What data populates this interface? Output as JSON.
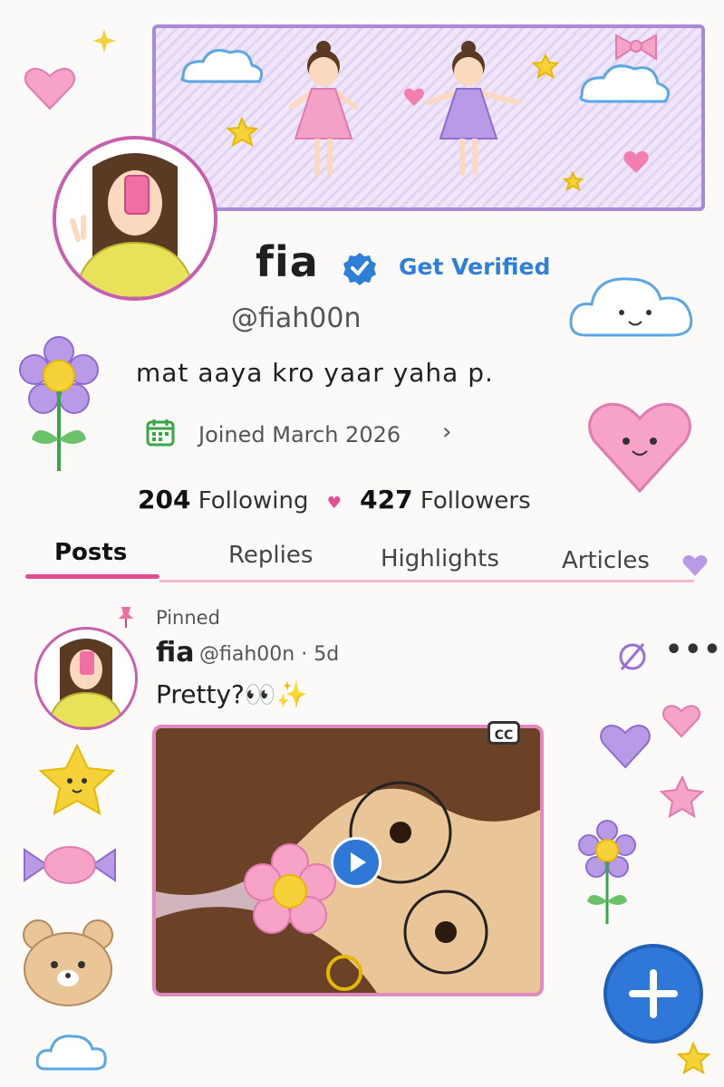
{
  "profile": {
    "name": "fia",
    "get_verified": "Get Verified",
    "handle": "@fiah00n",
    "bio": "mat aaya kro yaar yaha p.",
    "joined": "Joined March 2026",
    "following_count": "204",
    "following_label": "Following",
    "followers_count": "427",
    "followers_label": "Followers"
  },
  "tabs": [
    {
      "label": "Posts",
      "active": true
    },
    {
      "label": "Replies",
      "active": false
    },
    {
      "label": "Highlights",
      "active": false
    },
    {
      "label": "Articles",
      "active": false
    }
  ],
  "post": {
    "pinned_label": "Pinned",
    "author_name": "fia",
    "meta": "@fiah00n · 5d",
    "text": "Pretty?👀✨",
    "cc_label": "CC"
  },
  "icons": {
    "verified": "verified-badge-icon",
    "calendar": "calendar-icon",
    "chevron": "chevron-right-icon",
    "pin": "pin-icon",
    "grok": "grok-icon",
    "more": "more-icon",
    "play": "play-icon",
    "compose": "plus-icon"
  },
  "colors": {
    "accent_pink": "#e04f92",
    "verified_blue": "#2d7fd8",
    "banner_purple": "#a98ad6",
    "fab_blue": "#2f78d8"
  }
}
